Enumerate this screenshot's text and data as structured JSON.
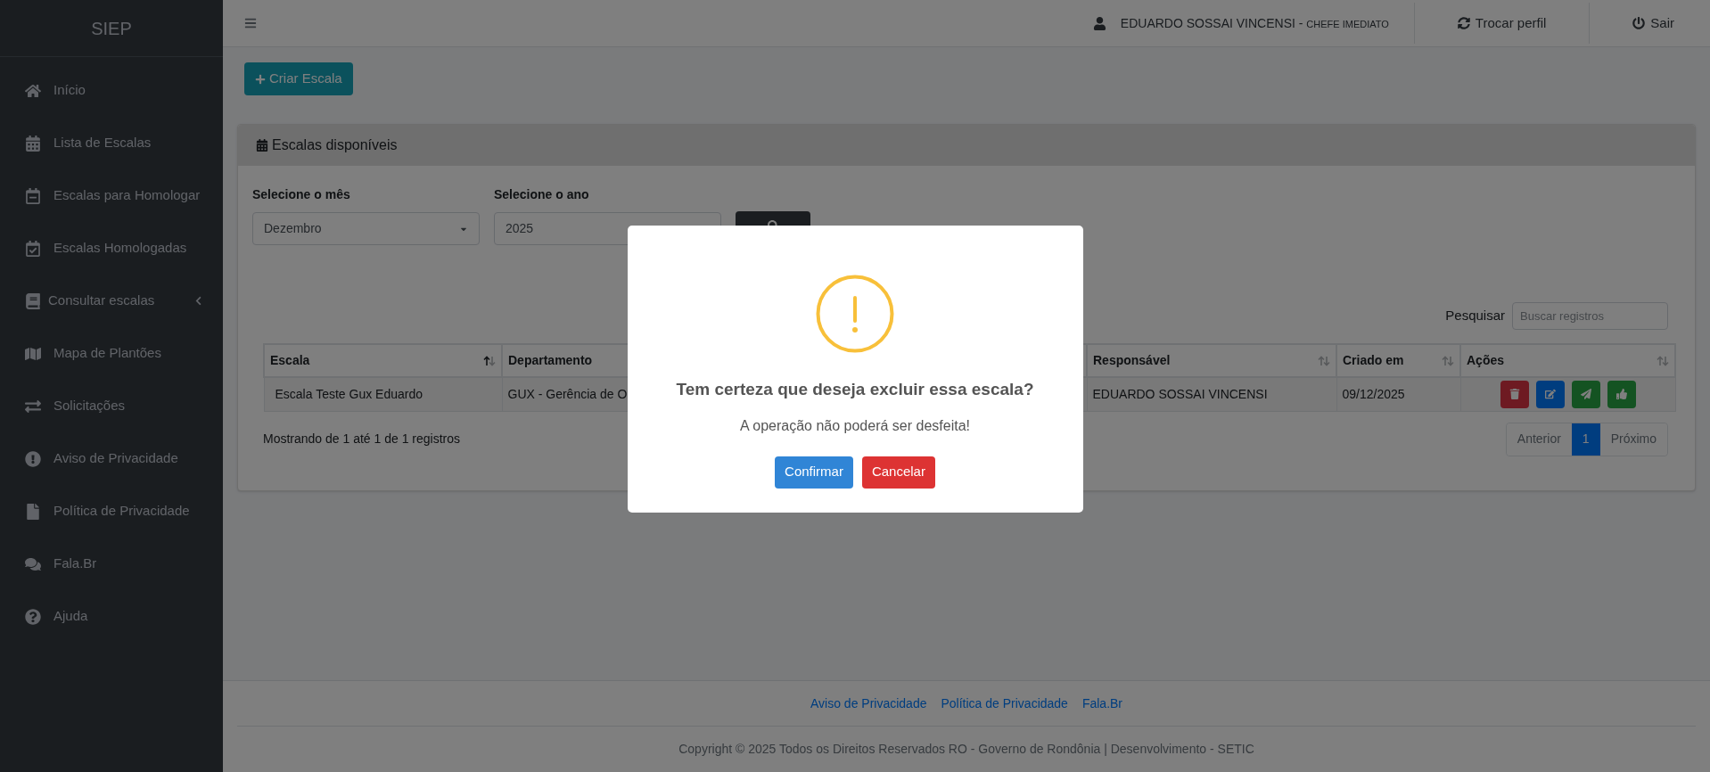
{
  "sidebar": {
    "brand": "SIEP",
    "items": [
      {
        "label": "Início",
        "expandable": false
      },
      {
        "label": "Lista de Escalas",
        "expandable": false
      },
      {
        "label": "Escalas para Homologar",
        "expandable": false
      },
      {
        "label": "Escalas Homologadas",
        "expandable": false
      },
      {
        "label": "Consultar escalas",
        "expandable": true
      },
      {
        "label": "Mapa de Plantões",
        "expandable": false
      },
      {
        "label": "Solicitações",
        "expandable": false
      },
      {
        "label": "Aviso de Privacidade",
        "expandable": false
      },
      {
        "label": "Política de Privacidade",
        "expandable": false
      },
      {
        "label": "Fala.Br",
        "expandable": false
      },
      {
        "label": "Ajuda",
        "expandable": false
      }
    ]
  },
  "topbar": {
    "user": {
      "name": "EDUARDO SOSSAI VINCENSI",
      "separator": " - ",
      "role": "CHEFE IMEDIATO"
    },
    "actions": [
      {
        "label": "Trocar perfil"
      },
      {
        "label": "Sair"
      }
    ]
  },
  "create_button": "Criar Escala",
  "card": {
    "title": "Escalas disponíveis",
    "month": {
      "label": "Selecione o mês",
      "value": "Dezembro"
    },
    "year": {
      "label": "Selecione o ano",
      "value": "2025"
    },
    "search": {
      "label": "Pesquisar",
      "placeholder": "Buscar registros"
    },
    "table": {
      "columns": [
        {
          "label": "Escala",
          "sorted": true
        },
        {
          "label": "Departamento"
        },
        {
          "label": "Responsável",
          "sorted": false
        },
        {
          "label": "Criado em",
          "sorted": false
        },
        {
          "label": "Ações",
          "sorted": false
        }
      ],
      "rows": [
        {
          "cells": [
            "Escala Teste Gux Eduardo",
            "GUX - Gerência de O",
            "EDUARDO SOSSAI VINCENSI",
            "09/12/2025"
          ],
          "actions": [
            {
              "kind": "delete"
            },
            {
              "kind": "edit"
            },
            {
              "kind": "send"
            },
            {
              "kind": "approve"
            }
          ]
        }
      ]
    },
    "info": "Mostrando de 1 até 1 de 1 registros",
    "pagination": {
      "previous": "Anterior",
      "pages": [
        {
          "label": "1",
          "selected": true
        }
      ],
      "next": "Próximo"
    }
  },
  "footer": {
    "links": [
      "Aviso de Privacidade",
      "Política de Privacidade",
      "Fala.Br"
    ],
    "copyright": "Copyright © 2025 Todos os Direitos Reservados RO - Governo de Rondônia | Desenvolvimento - SETIC"
  },
  "modal": {
    "title": "Tem certeza que deseja excluir essa escala?",
    "message": "A operação não poderá ser desfeita!",
    "buttons": [
      {
        "label": "Confirmar",
        "kind": "confirm"
      },
      {
        "label": "Cancelar",
        "kind": "cancel"
      }
    ]
  }
}
